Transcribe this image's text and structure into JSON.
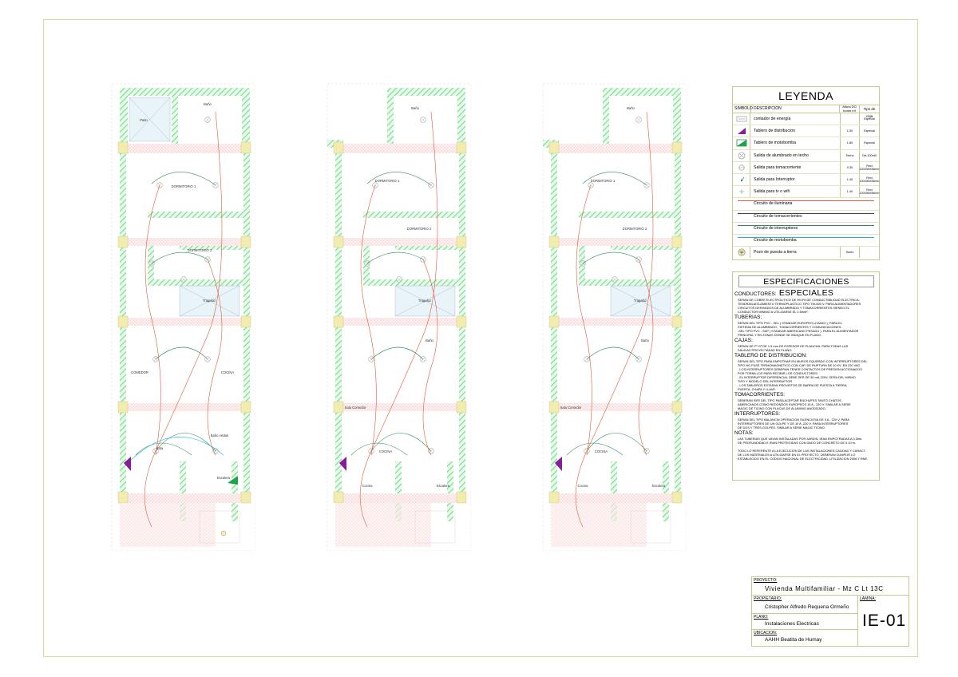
{
  "legend": {
    "title": "LEYENDA",
    "headers": {
      "symbol": "SIMBOLO",
      "description": "DESCRIPCION",
      "height": "Altura DO borde inf",
      "box": "Tipo de caja"
    },
    "rows": [
      {
        "icon": "energy-meter-icon",
        "description": "contador de energía",
        "height": "",
        "box": "Especial"
      },
      {
        "icon": "distribution-board-icon",
        "description": "Tablero de distribucion",
        "height": "1.50",
        "box": "Especial"
      },
      {
        "icon": "pump-board-icon",
        "description": "Tablero de motobomba",
        "height": "1.80",
        "box": "Especial"
      },
      {
        "icon": "ceiling-light-outlet-icon",
        "description": "Salida de alumbrado en techo",
        "height": "Techo",
        "box": "Oct-100x40"
      },
      {
        "icon": "socket-outlet-icon",
        "description": "Salida para tomacorriente",
        "height": "0.30",
        "box": "Rect 100X55X55mm"
      },
      {
        "icon": "switch-outlet-icon",
        "description": "Salida para Interruptor",
        "height": "1.40",
        "box": "Rect 100X55X55mm"
      },
      {
        "icon": "tv-wifi-outlet-icon",
        "description": "Salida para tv o wifi",
        "height": "1.40",
        "box": "Rect 100X55X55mm"
      }
    ],
    "circuits": [
      {
        "description": "Circuito de iluminaria",
        "color": "#e05a3a"
      },
      {
        "description": "Circuito de tomacorrientes",
        "color": "#444444"
      },
      {
        "description": "Circuito de interruptores",
        "color": "#2e8b57"
      },
      {
        "description": "Circuito de motobomba",
        "color": "#17b8d8"
      }
    ],
    "ground": {
      "icon": "ground-well-icon",
      "description": "Pozo de puesta a tierra",
      "height": "Suelo",
      "box": ""
    }
  },
  "specs": {
    "title": "ESPECIFICACIONES ESPECIALES",
    "sections": [
      {
        "heading": "CONDUCTORES:",
        "text": "SERAN DE COBRE ELECTROLITICO DE 99.9% DE CONDUCTIBILIDAD ELECTRICA;\nTENDRAN AISLAMIENTO TERMOPLASTICO TIPO TW-600 V. PARA ALIMENTADORES\nCIRCUITOS DERIVADOS DE ALUMBRADO Y TOMACORRIENTES,SIENDO EL\nCONDUCTOR MINIMO A UTILIZARSE EL 2.5mm²."
      },
      {
        "heading": "TUBERIAS:",
        "text": "SERAN DEL TIPO PVC - SEL ( STANDAR EUROPEO LIVIANO ), PARA EL\nSISTEMA DE ALUMBRADO , TOMACORRIENTES Y COMUNICACIONES.\n-SEL TIPO PVC - SAP ( STANDAR AMERICANO PESADO ), PARA EL ALIMENTADOR\nPRINCIPAL Y EN ZONAS DONDE SE INDIQUE EN PLANO."
      },
      {
        "heading": "CAJAS:",
        "text": "SERAN DE Fº Gº DE 1.5 mm DE ESPESOR DE PLANCHA, PARA TODAS LAS\nSALIDAS PROYECTADAS EN PLANO."
      },
      {
        "heading": "TABLERO DE DISTRIBUCION:",
        "text": "SERAN DEL TIPO PARA EMPOTRAR EN MUROS EQUIPADO CON INTERRUPTORES DEL\nTIPO NO FUSE TERMOMAGNETICO CON CAP. DE RUPTURA DE 10 KV. EN 220 VAC.\n- LOS INTERRUPTORES DEBERAN TENER CONTACTOS DE PRESION ACCIONADOS\nPOR TORNILLOS PARA RECIBIR LOS CONDUCTORES.\n- EL INTERRUPTOR DIFERENCIAL DEBE SER DE 30 mA-220V, SERA DEL MISMO\nTIPO Y MODELO DEL INTERRUPTOR\n- LOS TABLEROS ESTARAN PROVISTOS DE BARRA DE PUESTA A TIERRA,\nPUERTA, CHAPA Y LLAVE."
      },
      {
        "heading": "TOMACORRIENTES:",
        "text": "DEBERAN SER DEL TIPO PARA ACEPTAR ENCHUFES TANTO CHATOS\nAMERICANOS COMO REDONDOS EUROPEOS 15 A - 220 V. SIMILAR A SERIE\nMAGIC DE TICINO CON PLACAS DE ALUMINIO ANODIZADO."
      },
      {
        "heading": "INTERRUPTORES:",
        "text": "SERAN DEL TIPO BALANCIN OPERACION SILENCIOSA DE 3 A - 220 V, PARA\nINTERRUPTORES DE UN GOLPE Y DE 10 A -220 V. PARA INTERRUPTORES\nDE DOS Y TRES GOLPES. SIMILAR A SERIE MAGIC TICINO."
      },
      {
        "heading": "NOTAS:",
        "text": "LAS TUBERIAS QUE VAYAN INSTALADAS POR JARDIN, IRAN EMPOTRADAS A 0.30m.\nDE PROFUNDIDAD E IRAN PROTEGIDAS CON DADO DE CONCRETO DE 0.10 m.\n\nTODO LO REFERENTE A LA EJECUCION DE LAS INSTALACIONES,CALIDAD Y CARACT.\nDE LOS MATERIALES A UTILIZARSE EN EL PROYECTO, DEBERAN CUMPLIR LO\nESTABLECIDO EN EL CODIGO NACIONAL DE ELECTRICIDAD -UTILIZACION 2006 Y RNE."
      }
    ]
  },
  "title_block": {
    "project_label": "PROYECTO:",
    "project": "Vivienda Multifamiliar - Mz C Lt 13C",
    "owner_label": "PROPIETARIO:",
    "owner": "Cristopher Alfredo Requena Ormeño",
    "sheet_label": "LAMINA:",
    "sheet": "IE-01",
    "plan_label": "PLANO:",
    "plan": "Instalaciones Electricas",
    "location_label": "UBICACION:",
    "location": "AAHH Beatita de Humay"
  },
  "plans": [
    {
      "id": "floor-1",
      "rooms": [
        "Patio",
        "Baño",
        "DORMITORIO 1",
        "DORMITORIO 2",
        "Tragaluz",
        "COMEDOR",
        "COCINA",
        "Sala",
        "Baño visitas",
        "Escalera"
      ]
    },
    {
      "id": "floor-2",
      "rooms": [
        "Baño",
        "DORMITORIO 1",
        "DORMITORIO 2",
        "Tragaluz",
        "Baño",
        "Sala Comedor",
        "COCINA",
        "Cocina",
        "Escalera"
      ]
    },
    {
      "id": "floor-3",
      "rooms": [
        "Baño",
        "DORMITORIO 1",
        "DORMITORIO 2",
        "Tragaluz",
        "Baño",
        "Sala Comedor",
        "COCINA",
        "Cocina",
        "Escalera"
      ]
    }
  ],
  "colors": {
    "wall": "#7ddc9a",
    "column": "#f2ecb0",
    "slab": "#f4c8c8",
    "frame": "#d8d8a0",
    "lighting": "#e05a3a",
    "switch": "#2e8b57",
    "pump": "#17b8d8",
    "board": "#8a1b9a"
  }
}
